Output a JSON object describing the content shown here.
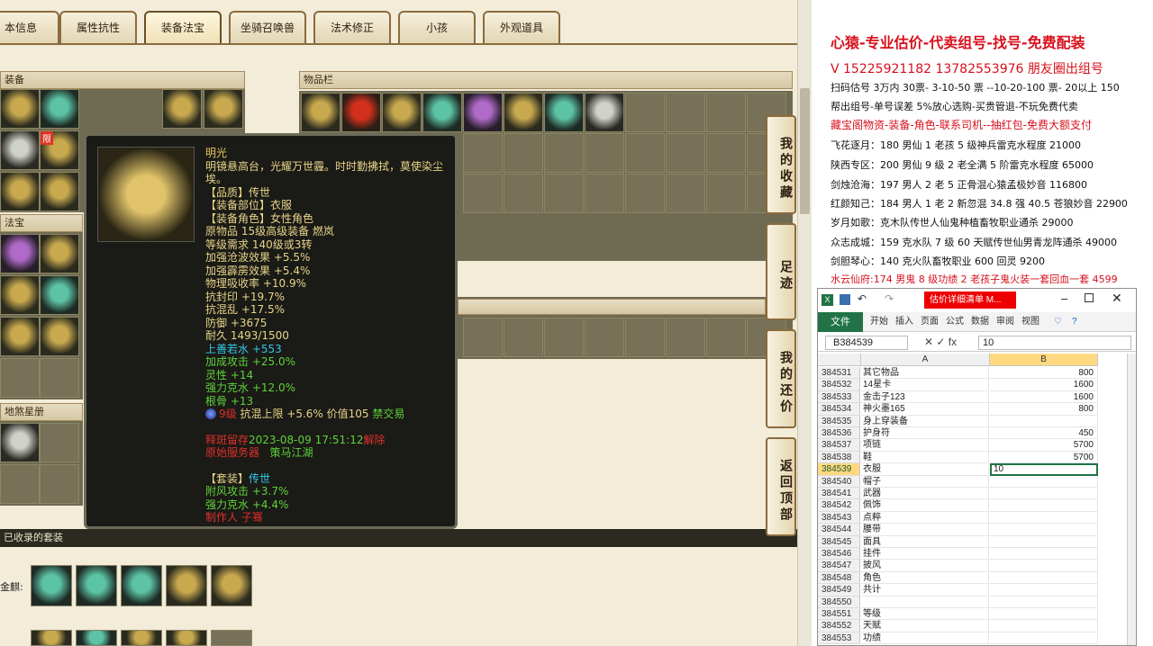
{
  "tabs": [
    "本信息",
    "属性抗性",
    "装备法宝",
    "坐骑召唤兽",
    "法术修正",
    "小孩",
    "外观道具"
  ],
  "active_tab": 2,
  "panels": {
    "equip": "装备",
    "treasure": "法宝",
    "stars": "地煞星册",
    "bag": "物品栏",
    "collected": "已收录的套装",
    "set_label": "金麒:"
  },
  "limit_badge": "限",
  "side_buttons": [
    "我的收藏",
    "足迹",
    "我的还价",
    "返回顶部"
  ],
  "tooltip": {
    "name": "明光",
    "desc": "明镜悬高台，光耀万世霾。时时勤拂拭，莫使染尘埃。",
    "quality": "【品质】传世",
    "part": "【装备部位】衣服",
    "role": "【装备角色】女性角色",
    "origin": "原物品 15级高级装备 燃岚",
    "req": "等级需求 140级或3转",
    "stats": [
      "加强沧波效果 +5.5%",
      "加强霹雳效果 +5.4%",
      "物理吸收率 +10.9%",
      "抗封印 +19.7%",
      "抗混乱 +17.5%",
      "防御 +3675",
      "耐久 1493/1500"
    ],
    "bonus": "上善若水 +553",
    "green_stats": [
      "加成攻击 +25.0%",
      "灵性 +14",
      "强力克水 +12.0%",
      "根骨 +13"
    ],
    "gem_pre": "9级 ",
    "gem_mid": "抗混上限 +5.6% 价值105 ",
    "gem_post": "禁交易",
    "time_pre": "释斑留存",
    "time": "2023-08-09 17:51:12",
    "time_post": "解除",
    "server_label": "原始服务器",
    "server": "策马江湖",
    "set_title": "【套装】",
    "set_name": "传世",
    "set_stats": [
      "附风攻击 +3.7%",
      "强力克水 +4.4%"
    ],
    "maker": "制作人 子骞"
  },
  "doc": {
    "title": "心猿-专业估价-代卖组号-找号-免费配装",
    "contact": "V 15225921182    13782553976 朋友圈出组号",
    "lines": [
      "扫码估号 3万内 30票- 3-10-50 票  --10-20-100 票- 20以上 150",
      "帮出组号-单号误差 5%放心选购-买贵管退-不玩免费代卖",
      "藏宝阁物资-装备-角色-联系司机--抽红包-免费大额支付",
      "飞花逐月：180 男仙 1 老孩 5 级神兵雷克水程度 21000",
      "陕西专区：200 男仙 9 级 2 老全满 5 阶雷克水程度 65000",
      "剑烛沧海：197 男人 2 老 5 正骨混心猿孟极妙音 116800",
      "红颜知己：184 男人 1 老 2 新忽混 34.8 强 40.5 苍狼妙音 22900",
      "岁月如歌：克木队传世人仙鬼种植畜牧职业通杀 29000",
      "众志成城：159 克水队 7 级 60 天赋传世仙男青龙阵通杀 49000",
      "剑胆琴心：140 克火队畜牧职业 600 回灵 9200",
      "水云仙府:174 男鬼 8 级功绩 2 老孩子鬼火装一套回血一套 4599"
    ]
  },
  "excel": {
    "title_tag": "估价详细清单 M...",
    "file": "文件",
    "ribbon": [
      "开始",
      "插入",
      "页面",
      "公式",
      "数据",
      "审阅",
      "视图"
    ],
    "cell_ref": "B384539",
    "formula": "10",
    "col_a": "A",
    "col_b": "B",
    "rows": [
      {
        "n": "384531",
        "a": "其它物品",
        "b": "800"
      },
      {
        "n": "384532",
        "a": "14星卡",
        "b": "1600"
      },
      {
        "n": "384533",
        "a": "金击子123",
        "b": "1600"
      },
      {
        "n": "384534",
        "a": "神火墨165",
        "b": "800"
      },
      {
        "n": "384535",
        "a": "身上穿装备",
        "b": ""
      },
      {
        "n": "384536",
        "a": "护身符",
        "b": "450"
      },
      {
        "n": "384537",
        "a": "项链",
        "b": "5700"
      },
      {
        "n": "384538",
        "a": "鞋",
        "b": "5700"
      },
      {
        "n": "384539",
        "a": "衣服",
        "b": "10"
      },
      {
        "n": "384540",
        "a": "帽子",
        "b": ""
      },
      {
        "n": "384541",
        "a": "武器",
        "b": ""
      },
      {
        "n": "384542",
        "a": "佩饰",
        "b": ""
      },
      {
        "n": "384543",
        "a": "点粹",
        "b": ""
      },
      {
        "n": "384544",
        "a": "腰带",
        "b": ""
      },
      {
        "n": "384545",
        "a": "面具",
        "b": ""
      },
      {
        "n": "384546",
        "a": "挂件",
        "b": ""
      },
      {
        "n": "384547",
        "a": "披风",
        "b": ""
      },
      {
        "n": "384548",
        "a": "角色",
        "b": ""
      },
      {
        "n": "384549",
        "a": "共计",
        "b": ""
      },
      {
        "n": "384550",
        "a": "",
        "b": ""
      },
      {
        "n": "384551",
        "a": "等级",
        "b": ""
      },
      {
        "n": "384552",
        "a": "天赋",
        "b": ""
      },
      {
        "n": "384553",
        "a": "功绩",
        "b": ""
      }
    ],
    "selected_row": 8
  },
  "colors": {
    "accent_red": "#d8101c",
    "excel_green": "#217346",
    "stat_green": "#5fd23a"
  }
}
